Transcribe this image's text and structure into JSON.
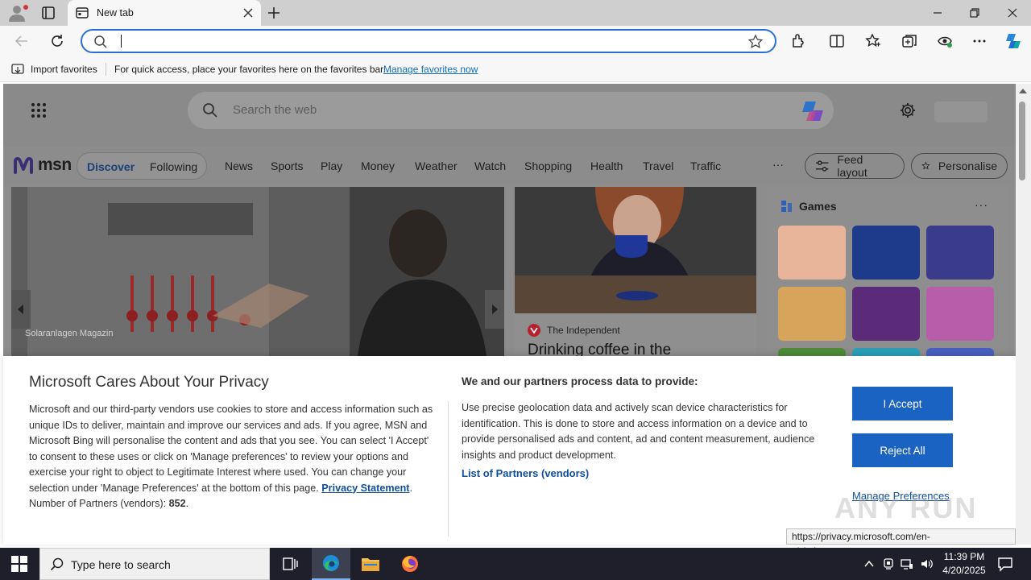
{
  "browser": {
    "tab_title": "New tab",
    "address_value": "",
    "favorites_bar": {
      "import_label": "Import favorites",
      "hint": "For quick access, place your favorites here on the favorites bar.",
      "manage_link": "Manage favorites now"
    }
  },
  "msn": {
    "search_placeholder": "Search the web",
    "logo_text": "msn",
    "pill": {
      "discover": "Discover",
      "following": "Following"
    },
    "nav_items": [
      "News",
      "Sports",
      "Play",
      "Money",
      "Weather",
      "Watch",
      "Shopping",
      "Health",
      "Travel",
      "Traffic"
    ],
    "more_label": "···",
    "feed_layout_label": "Feed layout",
    "personalise_label": "Personalise",
    "hero_source": "Solaranlagen Magazin",
    "card2_source": "The Independent",
    "card2_headline": "Drinking coffee in the",
    "games_title": "Games",
    "games_more": "···",
    "game_tiles": [
      {
        "name": "game-tile-1",
        "color": "#e8b49a"
      },
      {
        "name": "game-tile-2",
        "color": "#1e3a8a"
      },
      {
        "name": "game-tile-3",
        "color": "#3b3b8c"
      },
      {
        "name": "game-tile-4",
        "color": "#d7a45c"
      },
      {
        "name": "game-tile-5",
        "color": "#5b2b7a"
      },
      {
        "name": "game-tile-6",
        "color": "#b85da8"
      },
      {
        "name": "game-tile-7",
        "color": "#4f8a3a"
      },
      {
        "name": "game-tile-8",
        "color": "#2aa0b8"
      },
      {
        "name": "game-tile-9",
        "color": "#4a5fc2"
      }
    ]
  },
  "privacy": {
    "title": "Microsoft Cares About Your Privacy",
    "body": "Microsoft and our third-party vendors use cookies to store and access information such as unique IDs to deliver, maintain and improve our services and ads. If you agree, MSN and Microsoft Bing will personalise the content and ads that you see. You can select 'I Accept' to consent to these uses or click on 'Manage preferences' to review your options and exercise your right to object to Legitimate Interest where used.  You can change your selection under 'Manage Preferences' at the bottom of this page.",
    "privacy_link": "Privacy Statement",
    "partners_count_label": "Number of Partners (vendors):",
    "partners_count": "852",
    "right_title": "We and our partners process data to provide:",
    "right_body": "Use precise geolocation data and actively scan device characteristics for identification. This is done to store and access information on a device and to provide personalised ads and content, ad and content measurement, audience insights and product development.",
    "partners_link": "List of Partners (vendors)",
    "accept_label": "I Accept",
    "reject_label": "Reject All",
    "manage_label": "Manage Preferences",
    "status_url": "https://privacy.microsoft.com/en-gb/privacystatement",
    "watermark": "ANY RUN"
  },
  "taskbar": {
    "search_placeholder": "Type here to search",
    "time": "11:39 PM",
    "date": "4/20/2025"
  },
  "colors": {
    "accent": "#1a63c2",
    "link": "#0f4f9e",
    "taskbar": "#1f1f2b"
  }
}
